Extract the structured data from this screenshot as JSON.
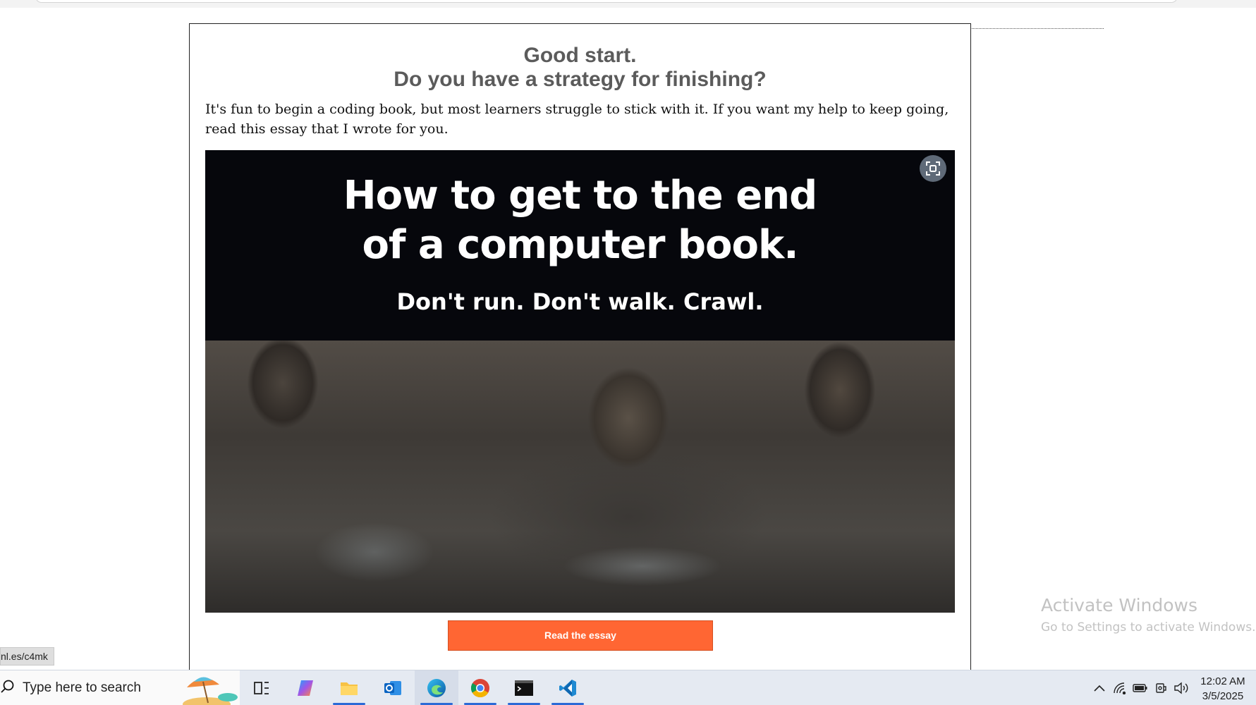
{
  "dialog": {
    "heading_line1": "Good start.",
    "heading_line2": "Do you have a strategy for finishing?",
    "intro": "It's fun to begin a coding book, but most learners struggle to stick with it. If you want my help to keep going, read this essay that I wrote for you.",
    "hero": {
      "title_line1": "How to get to the end",
      "title_line2": "of a computer book.",
      "subtitle": "Don't run. Don't walk. Crawl.",
      "fullscreen_icon": "fullscreen-icon"
    },
    "cta_label": "Read the essay"
  },
  "status_bar_url": "nl.es/c4mk",
  "watermark": {
    "title": "Activate Windows",
    "subtitle": "Go to Settings to activate Windows."
  },
  "taskbar": {
    "search_placeholder": "Type here to search",
    "apps": [
      "task-view",
      "copilot",
      "file-explorer",
      "outlook",
      "edge",
      "chrome",
      "terminal",
      "vscode"
    ],
    "clock_time": "12:02 AM",
    "clock_date": "3/5/2025"
  },
  "colors": {
    "cta": "#ff6633",
    "heading": "#5b5b5b",
    "hero_bg": "#06070c",
    "taskbar": "#e5eaf2"
  }
}
